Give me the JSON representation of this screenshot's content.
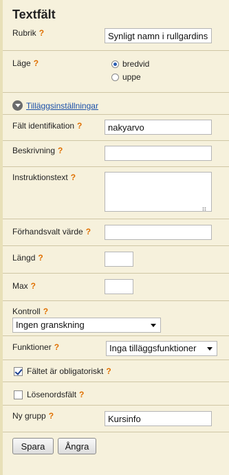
{
  "title": "Textfält",
  "help_mark": "?",
  "rubrik": {
    "label": "Rubrik",
    "value": "Synligt namn i rullgardinsmenyn"
  },
  "lage": {
    "label": "Läge",
    "options": [
      "bredvid",
      "uppe"
    ],
    "selected": "bredvid"
  },
  "advanced": {
    "label": "Tilläggsinställningar"
  },
  "falt_id": {
    "label": "Fält identifikation",
    "value": "nakyarvo"
  },
  "beskrivning": {
    "label": "Beskrivning",
    "value": ""
  },
  "instruktion": {
    "label": "Instruktionstext",
    "value": ""
  },
  "forhandsvalt": {
    "label": "Förhandsvalt värde",
    "value": ""
  },
  "langd": {
    "label": "Längd",
    "value": ""
  },
  "max": {
    "label": "Max",
    "value": ""
  },
  "kontroll": {
    "label": "Kontroll",
    "selected": "Ingen granskning"
  },
  "funktioner": {
    "label": "Funktioner",
    "selected": "Inga tilläggsfunktioner"
  },
  "obligatoriskt": {
    "label": "Fältet är obligatoriskt",
    "checked": true
  },
  "losenord": {
    "label": "Lösenordsfält",
    "checked": false
  },
  "ny_grupp": {
    "label": "Ny grupp",
    "value": "Kursinfo"
  },
  "buttons": {
    "save": "Spara",
    "cancel": "Ångra"
  }
}
